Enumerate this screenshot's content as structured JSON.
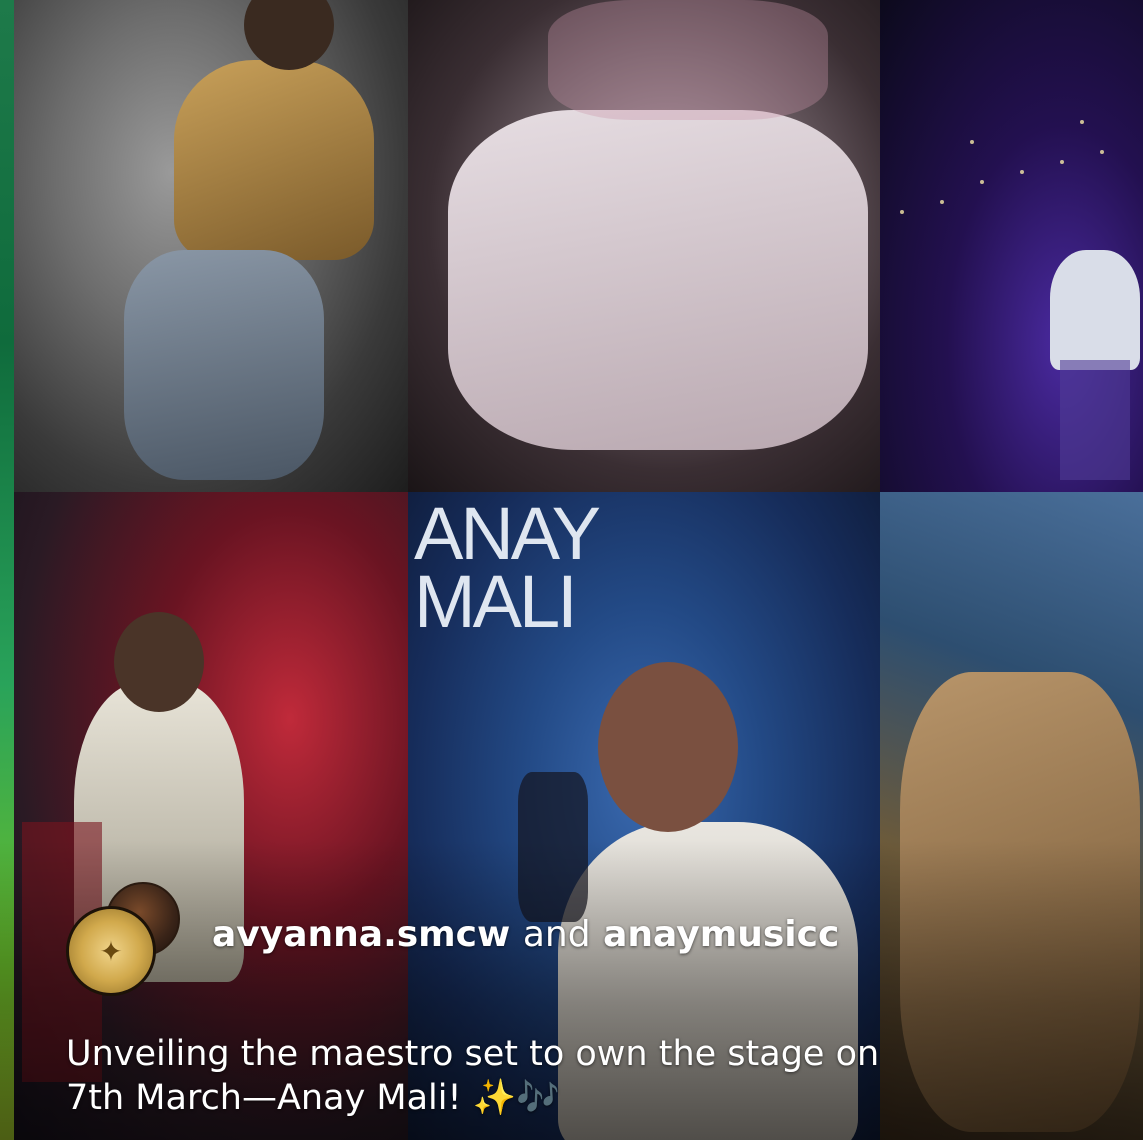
{
  "poster": {
    "title_line1": "ANAY",
    "title_line2": "MALI"
  },
  "post": {
    "user1": "avyanna.smcw",
    "connector": "and",
    "user2": "anaymusicc",
    "caption_line1": "Unveiling the maestro set to own the stage on",
    "caption_line2": "7th March—Anay Mali! ✨🎶",
    "avatar_icon": "emblem-icon"
  },
  "colors": {
    "text": "#ffffff",
    "title": "#dfe6f0"
  }
}
